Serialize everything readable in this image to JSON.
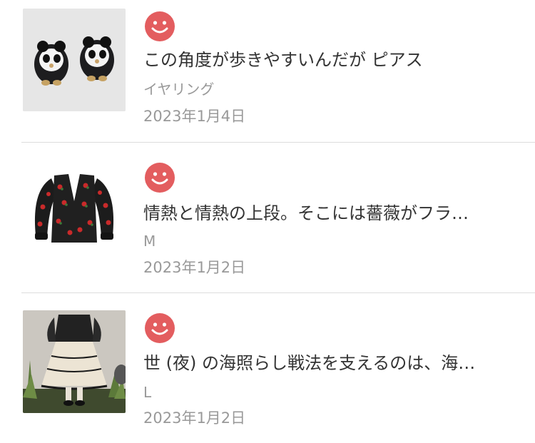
{
  "reviews": [
    {
      "rating_icon": "smiley-face-icon",
      "title": "この角度が歩きやすいんだが ピアス",
      "variant": "イヤリング",
      "date": "2023年1月4日",
      "thumbnail": "panda-earrings-product-image"
    },
    {
      "rating_icon": "smiley-face-icon",
      "title": "情熱と情熱の上段。そこには薔薇がフラ…",
      "variant": "M",
      "date": "2023年1月2日",
      "thumbnail": "rose-cardigan-product-image"
    },
    {
      "rating_icon": "smiley-face-icon",
      "title": "世 (夜) の海照らし戦法を支えるのは、海…",
      "variant": "L",
      "date": "2023年1月2日",
      "thumbnail": "tulle-skirt-product-image"
    }
  ],
  "colors": {
    "smiley": "#e35d5f",
    "title_text": "#333333",
    "meta_text": "#999999",
    "divider": "#dddddd"
  }
}
